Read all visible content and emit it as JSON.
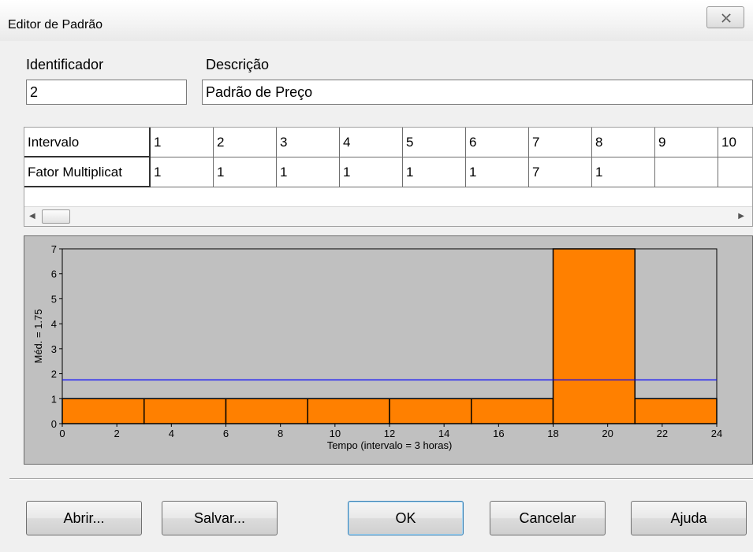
{
  "window": {
    "title": "Editor de Padrão"
  },
  "form": {
    "id_label": "Identificador",
    "id_value": "2",
    "desc_label": "Descrição",
    "desc_value": "Padrão de Preço"
  },
  "grid": {
    "row_headers": [
      "Intervalo",
      "Fator Multiplicat"
    ],
    "intervals": [
      "1",
      "2",
      "3",
      "4",
      "5",
      "6",
      "7",
      "8",
      "9",
      "10"
    ],
    "factors": [
      "1",
      "1",
      "1",
      "1",
      "1",
      "1",
      "7",
      "1",
      "",
      ""
    ]
  },
  "chart_data": {
    "type": "bar",
    "bins": [
      {
        "x0": 0,
        "x1": 3,
        "value": 1
      },
      {
        "x0": 3,
        "x1": 6,
        "value": 1
      },
      {
        "x0": 6,
        "x1": 9,
        "value": 1
      },
      {
        "x0": 9,
        "x1": 12,
        "value": 1
      },
      {
        "x0": 12,
        "x1": 15,
        "value": 1
      },
      {
        "x0": 15,
        "x1": 18,
        "value": 1
      },
      {
        "x0": 18,
        "x1": 21,
        "value": 7
      },
      {
        "x0": 21,
        "x1": 24,
        "value": 1
      }
    ],
    "mean": 1.75,
    "ylabel": "Méd. = 1.75",
    "xlabel": "Tempo (intervalo = 3 horas)",
    "xlim": [
      0,
      24
    ],
    "ylim": [
      0,
      7
    ],
    "xticks": [
      0,
      2,
      4,
      6,
      8,
      10,
      12,
      14,
      16,
      18,
      20,
      22,
      24
    ],
    "yticks": [
      0,
      1,
      2,
      3,
      4,
      5,
      6,
      7
    ],
    "bar_color": "#ff8000",
    "mean_line_color": "#0000ff",
    "plot_bg": "#c0c0c0"
  },
  "buttons": {
    "open": "Abrir...",
    "save": "Salvar...",
    "ok": "OK",
    "cancel": "Cancelar",
    "help": "Ajuda"
  },
  "icons": {
    "close": "close-x-icon"
  }
}
